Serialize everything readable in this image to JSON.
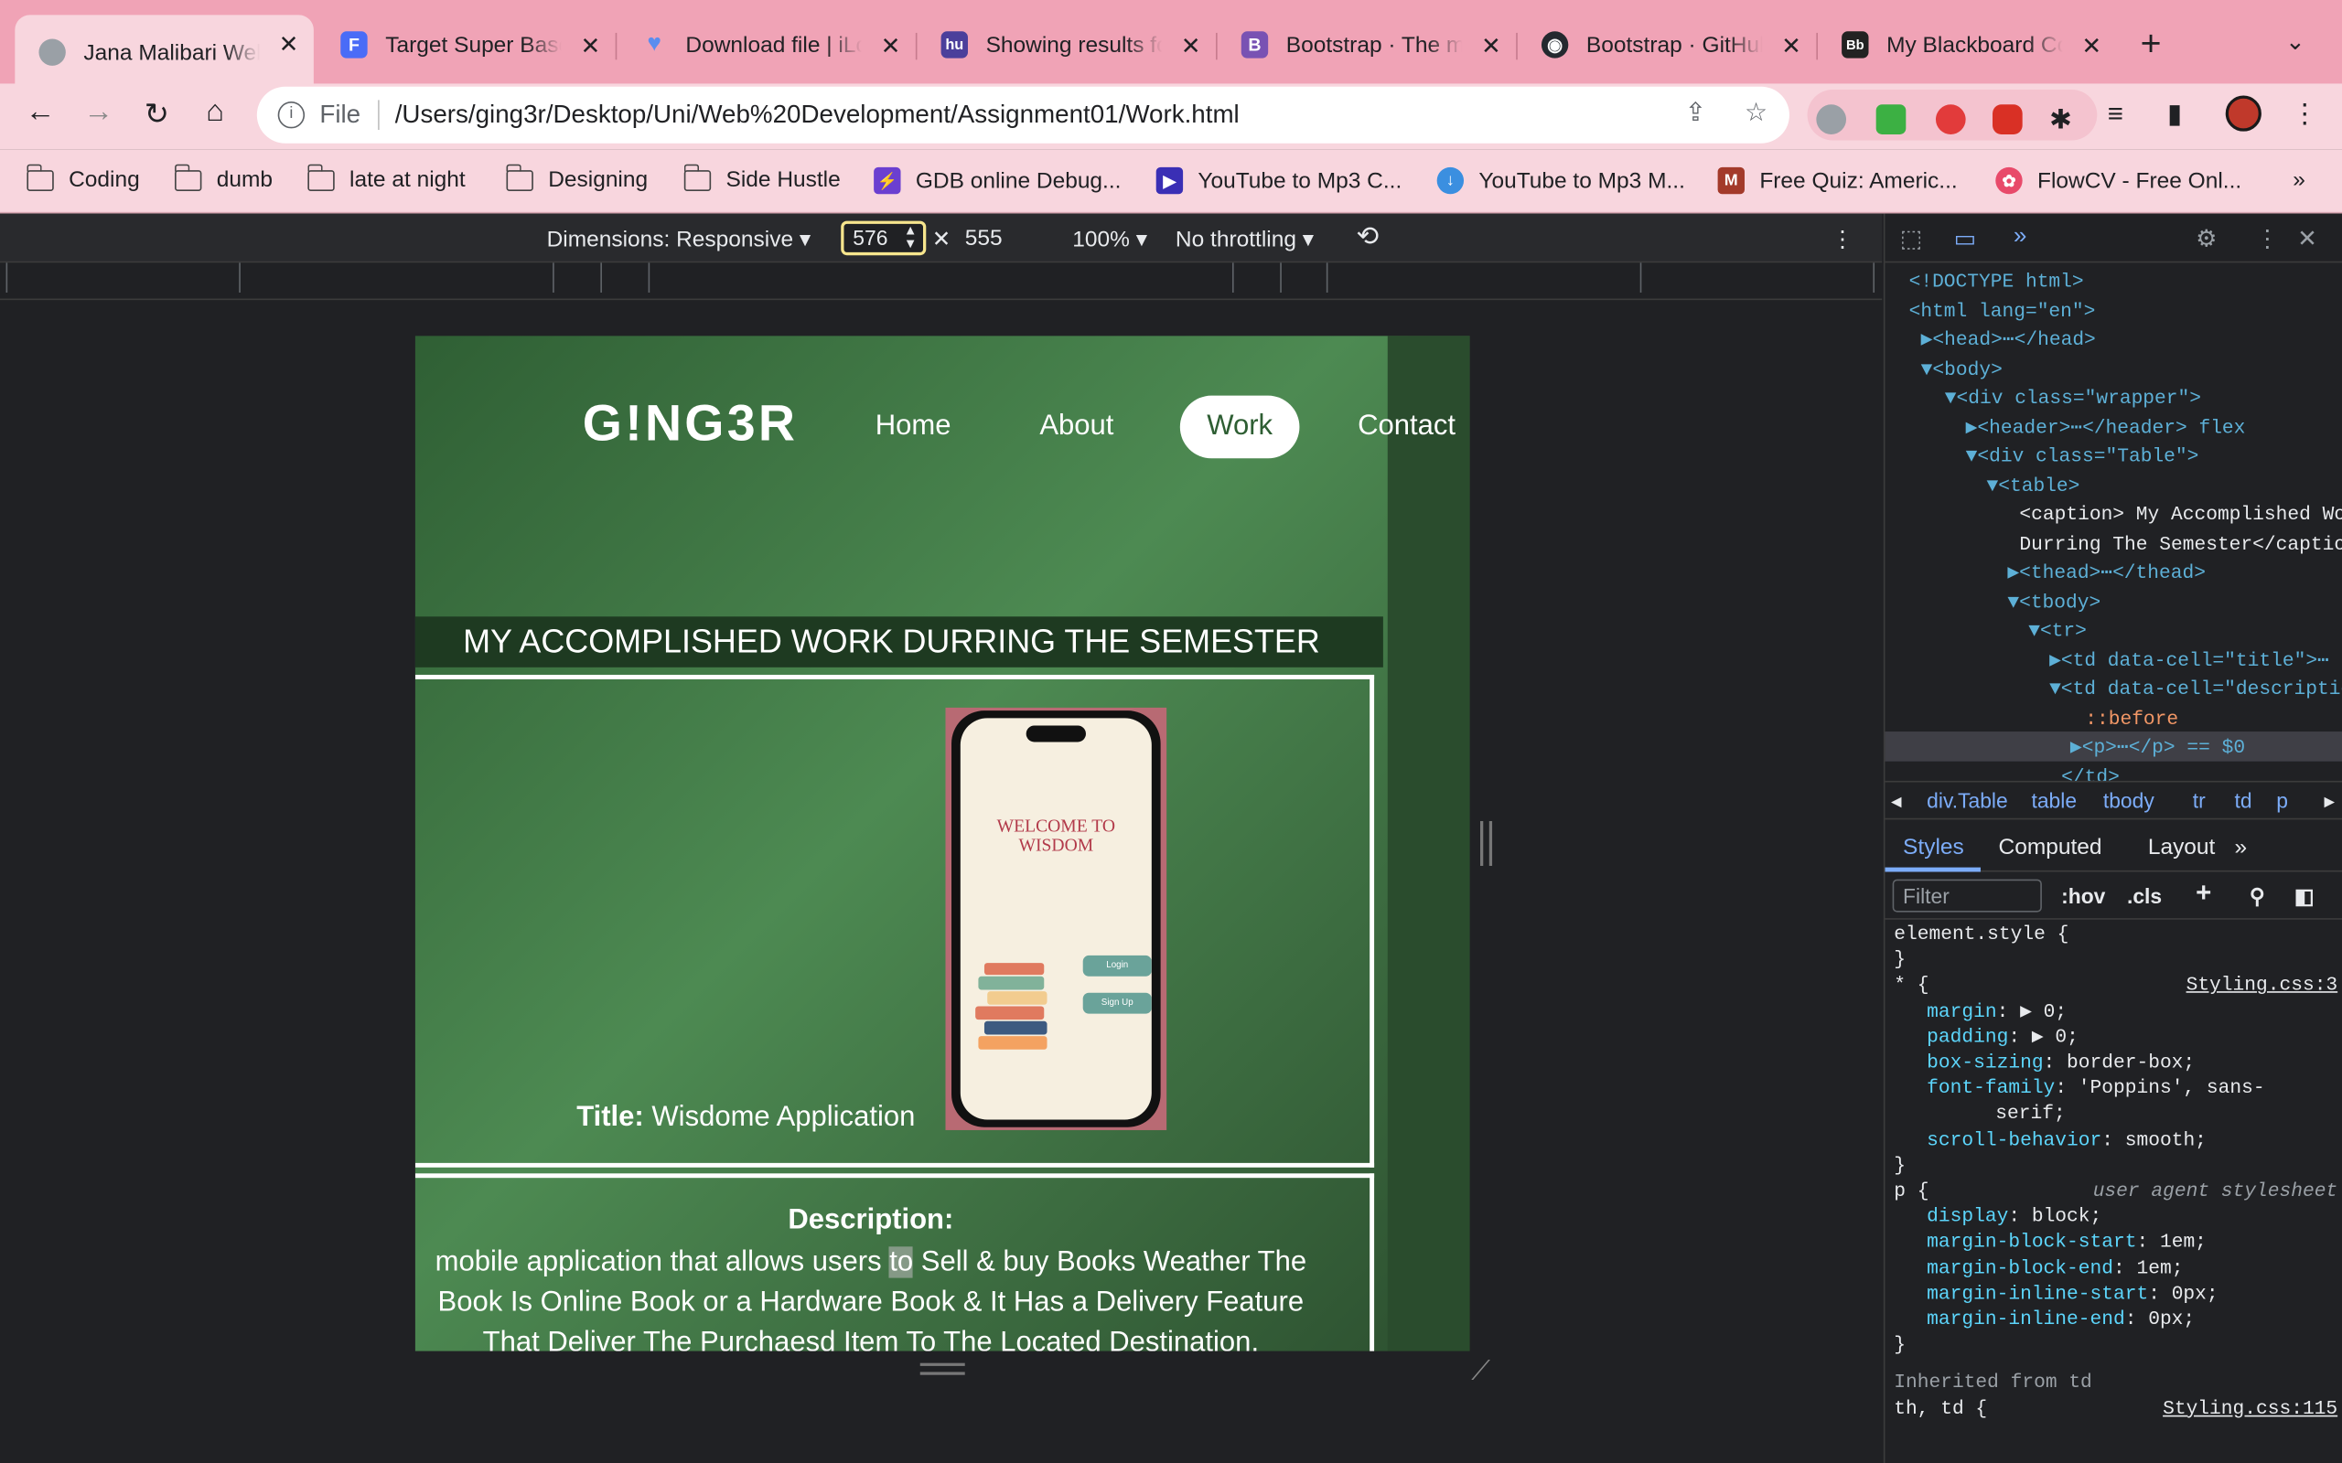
{
  "tabs": [
    {
      "title": "Jana Malibari Web",
      "color": "#9aa0a6",
      "glyph": "",
      "active": true
    },
    {
      "title": "Target Super Based",
      "color": "#4a6cf7",
      "glyph": "F",
      "active": false
    },
    {
      "title": "Download file | iLove",
      "color": "#5b8def",
      "glyph": "♥",
      "active": false
    },
    {
      "title": "Showing results for",
      "color": "#4b3f9b",
      "glyph": "hu",
      "active": false
    },
    {
      "title": "Bootstrap · The most",
      "color": "#7952b3",
      "glyph": "B",
      "active": false
    },
    {
      "title": "Bootstrap · GitHub",
      "color": "#24292f",
      "glyph": "◉",
      "active": false
    },
    {
      "title": "My Blackboard Courses",
      "color": "#222222",
      "glyph": "Bb",
      "active": false
    }
  ],
  "toolbar": {
    "file_label": "File",
    "url": "/Users/ging3r/Desktop/Uni/Web%20Development/Assignment01/Work.html"
  },
  "bookmarks": [
    {
      "label": "Coding",
      "type": "folder"
    },
    {
      "label": "dumb",
      "type": "folder"
    },
    {
      "label": "late at night",
      "type": "folder"
    },
    {
      "label": "Designing",
      "type": "folder"
    },
    {
      "label": "Side Hustle",
      "type": "folder"
    },
    {
      "label": "GDB online Debug...",
      "type": "site",
      "color": "#6b3fd0"
    },
    {
      "label": "YouTube to Mp3 C...",
      "type": "site",
      "color": "#3a2fb5"
    },
    {
      "label": "YouTube to Mp3 M...",
      "type": "site",
      "color": "#3b8fe0"
    },
    {
      "label": "Free Quiz: Americ...",
      "type": "site",
      "color": "#a33a2a"
    },
    {
      "label": "FlowCV - Free Onl...",
      "type": "site",
      "color": "#e84a6a"
    }
  ],
  "device": {
    "dimensions_label": "Dimensions: Responsive",
    "width": "576",
    "height": "555",
    "zoom": "100%",
    "throttle": "No throttling"
  },
  "site": {
    "logo": "G!NG3R",
    "nav": [
      "Home",
      "About",
      "Work",
      "Contact"
    ],
    "caption": "MY ACCOMPLISHED WORK DURRING THE SEMESTER",
    "title_label": "Title:",
    "title_value": "Wisdome Application",
    "phone_welcome": "WELCOME TO WISDOM",
    "phone_login": "Login",
    "phone_signup": "Sign Up",
    "desc_label": "Description:",
    "desc_before": "mobile application that allows users ",
    "desc_hl": "to",
    "desc_after": " Sell & buy Books Weather The Book Is Online Book or a Hardware Book & It Has a Delivery Feature That Deliver The Purchaesd Item To The Located Destination."
  },
  "devtools": {
    "dom": [
      {
        "t": "<!DOCTYPE html>"
      },
      {
        "t": "<html lang=\"en\">"
      },
      {
        "t": "▶<head>⋯</head>"
      },
      {
        "t": "▼<body>"
      },
      {
        "t": "▼<div class=\"wrapper\">"
      },
      {
        "t": "▶<header>⋯</header> flex"
      },
      {
        "t": "▼<div class=\"Table\">"
      },
      {
        "t": "▼<table>"
      },
      {
        "t": "<caption> My Accomplished Work"
      },
      {
        "t": "Durring The Semester</caption>"
      },
      {
        "t": "▶<thead>⋯</thead>"
      },
      {
        "t": "▼<tbody>"
      },
      {
        "t": "▼<tr>"
      },
      {
        "t": "▶<td data-cell=\"title\">⋯"
      },
      {
        "t": "▼<td data-cell=\"description\">"
      },
      {
        "t": "::before"
      },
      {
        "t": "▶<p>⋯</p> == $0"
      },
      {
        "t": "</td>"
      }
    ],
    "crumbs": [
      "div.Table",
      "table",
      "tbody",
      "tr",
      "td",
      "p"
    ],
    "panel_tabs": [
      "Styles",
      "Computed",
      "Layout"
    ],
    "filter_placeholder": "Filter",
    "hov": ":hov",
    "cls": ".cls",
    "css": [
      {
        "t": "element.style {"
      },
      {
        "t": "}"
      },
      {
        "t": "* {",
        "src": "Styling.css:3"
      },
      {
        "t": "margin: ▶ 0;"
      },
      {
        "t": "padding: ▶ 0;"
      },
      {
        "t": "box-sizing: border-box;"
      },
      {
        "t": "font-family: 'Poppins', sans-"
      },
      {
        "t": "serif;"
      },
      {
        "t": "scroll-behavior: smooth;"
      },
      {
        "t": "}"
      },
      {
        "t": "p {",
        "src": "user agent stylesheet"
      },
      {
        "t": "display: block;"
      },
      {
        "t": "margin-block-start: 1em;"
      },
      {
        "t": "margin-block-end: 1em;"
      },
      {
        "t": "margin-inline-start: 0px;"
      },
      {
        "t": "margin-inline-end: 0px;"
      },
      {
        "t": "}"
      },
      {
        "t": "Inherited from td"
      },
      {
        "t": "th, td {",
        "src": "Styling.css:115"
      }
    ]
  }
}
